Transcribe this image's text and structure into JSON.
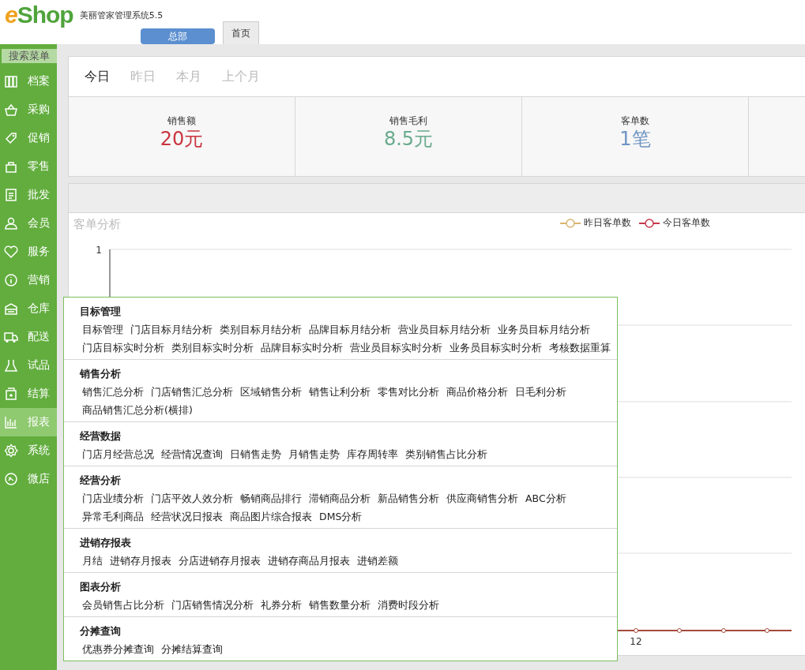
{
  "header": {
    "logo_e": "e",
    "logo_rest": "Shop",
    "product": "美丽管家管理系统5.5",
    "store_button": "总部",
    "tabs": [
      {
        "label": "首页",
        "selected": true
      }
    ]
  },
  "sidebar": {
    "search_button": "搜索菜单",
    "items": [
      {
        "label": "档案",
        "selected": false
      },
      {
        "label": "采购",
        "selected": false
      },
      {
        "label": "促销",
        "selected": false
      },
      {
        "label": "零售",
        "selected": false
      },
      {
        "label": "批发",
        "selected": false
      },
      {
        "label": "会员",
        "selected": false
      },
      {
        "label": "服务",
        "selected": false
      },
      {
        "label": "营销",
        "selected": false
      },
      {
        "label": "仓库",
        "selected": false
      },
      {
        "label": "配送",
        "selected": false
      },
      {
        "label": "试品",
        "selected": false
      },
      {
        "label": "结算",
        "selected": false
      },
      {
        "label": "报表",
        "selected": true
      },
      {
        "label": "系统",
        "selected": false
      },
      {
        "label": "微店",
        "selected": false
      }
    ]
  },
  "period_tabs": [
    {
      "label": "今日",
      "selected": true
    },
    {
      "label": "昨日",
      "selected": false
    },
    {
      "label": "本月",
      "selected": false
    },
    {
      "label": "上个月",
      "selected": false
    }
  ],
  "stats": [
    {
      "label": "销售额",
      "value": "20元",
      "color": "#c9353f"
    },
    {
      "label": "销售毛利",
      "value": "8.5元",
      "color": "#6aab8e"
    },
    {
      "label": "客单数",
      "value": "1笔",
      "color": "#6f94c3"
    }
  ],
  "chart_panel": {
    "title": "客单分析",
    "legend": [
      {
        "label": "昨日客单数",
        "color": "#d9b56e"
      },
      {
        "label": "今日客单数",
        "color": "#c4394b"
      }
    ],
    "y_tick": "1",
    "x_tick": "12"
  },
  "flyout_menu": {
    "sections": [
      {
        "title": "目标管理",
        "items": [
          "目标管理",
          "门店目标月结分析",
          "类别目标月结分析",
          "品牌目标月结分析",
          "营业员目标月结分析",
          "业务员目标月结分析",
          "门店目标实时分析",
          "类别目标实时分析",
          "品牌目标实时分析",
          "营业员目标实时分析",
          "业务员目标实时分析",
          "考核数据重算"
        ]
      },
      {
        "title": "销售分析",
        "items": [
          "销售汇总分析",
          "门店销售汇总分析",
          "区域销售分析",
          "销售让利分析",
          "零售对比分析",
          "商品价格分析",
          "日毛利分析",
          "商品销售汇总分析(横排)"
        ]
      },
      {
        "title": "经营数据",
        "items": [
          "门店月经营总况",
          "经营情况查询",
          "日销售走势",
          "月销售走势",
          "库存周转率",
          "类别销售占比分析"
        ]
      },
      {
        "title": "经营分析",
        "items": [
          "门店业绩分析",
          "门店平效人效分析",
          "畅销商品排行",
          "滞销商品分析",
          "新品销售分析",
          "供应商销售分析",
          "ABC分析",
          "异常毛利商品",
          "经营状况日报表",
          "商品图片综合报表",
          "DMS分析"
        ]
      },
      {
        "title": "进销存报表",
        "items": [
          "月结",
          "进销存月报表",
          "分店进销存月报表",
          "进销存商品月报表",
          "进销差额"
        ]
      },
      {
        "title": "图表分析",
        "items": [
          "会员销售占比分析",
          "门店销售情况分析",
          "礼券分析",
          "销售数量分析",
          "消费时段分析"
        ]
      },
      {
        "title": "分摊查询",
        "items": [
          "优惠券分摊查询",
          "分摊结算查询"
        ]
      }
    ]
  }
}
